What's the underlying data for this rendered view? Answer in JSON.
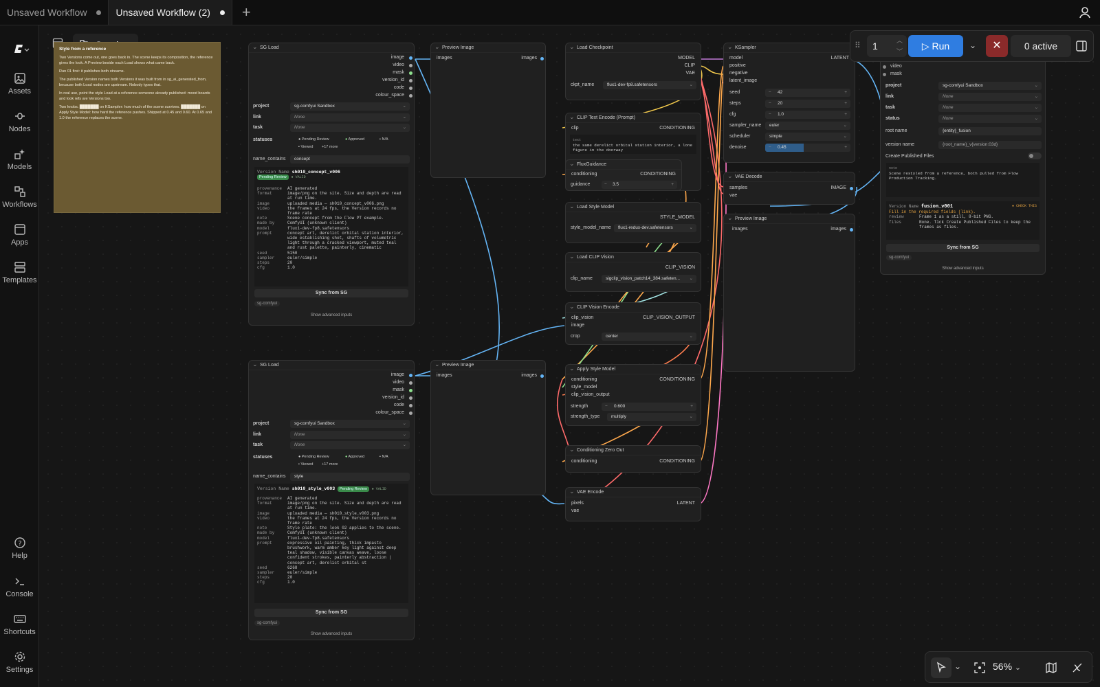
{
  "tabs": [
    {
      "label": "Unsaved Workflow",
      "active": false
    },
    {
      "label": "Unsaved Workflow (2)",
      "active": true
    }
  ],
  "sidebar": {
    "items": [
      {
        "label": "Assets",
        "icon": "image-icon"
      },
      {
        "label": "Nodes",
        "icon": "nodes-icon"
      },
      {
        "label": "Models",
        "icon": "models-icon"
      },
      {
        "label": "Workflows",
        "icon": "workflows-icon"
      },
      {
        "label": "Apps",
        "icon": "apps-icon"
      },
      {
        "label": "Templates",
        "icon": "templates-icon"
      }
    ],
    "bottom": [
      {
        "label": "Help"
      },
      {
        "label": "Console"
      },
      {
        "label": "Shortcuts"
      },
      {
        "label": "Settings"
      }
    ]
  },
  "graph_button": "Graph",
  "note": {
    "title": "Style from a reference",
    "paragraphs": [
      "Two Versions come out, one goes back in. The scene keeps its composition, the reference gives the look. A Preview beside each Load shows what came back.",
      "Run 01 first: it publishes both streams.",
      "The published Version names both Versions it was built from in sg_ai_generated_from, because both Load nodes are upstream. Nobody types that.",
      "In real use, point the style Load at a reference someone already published: mood boards and look refs are Versions too.",
      "Two knobs. ███████ on KSampler: how much of the scene survives. ███████ on Apply Style Model: how hard the reference pushes. Shipped at 0.45 and 0.60. At 0.65 and 1.0 the reference replaces the scene."
    ]
  },
  "sgload1": {
    "title": "SG Load",
    "outputs": [
      "image",
      "video",
      "mask",
      "version_id",
      "code",
      "colour_space"
    ],
    "project_label": "project",
    "project": "sg-comfyui Sandbox",
    "link_label": "link",
    "link": "None",
    "task_label": "task",
    "task": "None",
    "statuses_label": "statuses",
    "status1": "Pending Review",
    "status2": "Approved",
    "status3": "N/A",
    "status4": "Viewed",
    "more": "+17 more",
    "name_contains_label": "name_contains",
    "name_contains": "concept",
    "version_name_label": "Version Name",
    "version_name": "sh010_concept_v006",
    "badge": "Pending Review",
    "valid": "● VALID",
    "meta": [
      [
        "provenance",
        "AI generated"
      ],
      [
        "format",
        "image/png on the site. Size and depth are read at run time."
      ],
      [
        "image",
        "uploaded media — sh010_concept_v006.png"
      ],
      [
        "video",
        "the frames at 24 fps, the Version records no frame rate"
      ],
      [
        "note",
        "Scene concept from the Flow PT example."
      ],
      [
        "made by",
        "ComfyUI (unknown client)"
      ],
      [
        "model",
        "flux1-dev-fp8.safetensors"
      ],
      [
        "prompt",
        "concept art, derelict orbital station interior, wide establishing shot, shafts of volumetric light through a cracked viewport, muted teal and rust palette, painterly, cinematic"
      ],
      [
        "seed",
        "5150"
      ],
      [
        "sampler",
        "euler/simple"
      ],
      [
        "steps",
        "20"
      ],
      [
        "cfg",
        "1.0"
      ]
    ],
    "sync": "Sync from SG",
    "tag": "sg-comfyui",
    "advanced": "Show advanced inputs"
  },
  "sgload2": {
    "title": "SG Load",
    "outputs": [
      "image",
      "video",
      "mask",
      "version_id",
      "code",
      "colour_space"
    ],
    "project_label": "project",
    "project": "sg-comfyui Sandbox",
    "link_label": "link",
    "link": "None",
    "task_label": "task",
    "task": "None",
    "statuses_label": "statuses",
    "status1": "Pending Review",
    "status2": "Approved",
    "status3": "N/A",
    "status4": "Viewed",
    "more": "+17 more",
    "name_contains_label": "name_contains",
    "name_contains": "style",
    "version_name_label": "Version Name",
    "version_name": "sh010_style_v003",
    "badge": "Pending Review",
    "valid": "● VALID",
    "meta": [
      [
        "provenance",
        "AI generated"
      ],
      [
        "format",
        "image/png on the site. Size and depth are read at run time."
      ],
      [
        "image",
        "uploaded media — sh010_style_v003.png"
      ],
      [
        "video",
        "the frames at 24 fps, the Version records no frame rate"
      ],
      [
        "note",
        "Style plate: the look 02 applies to the scene."
      ],
      [
        "made by",
        "ComfyUI (unknown client)"
      ],
      [
        "model",
        "flux1-dev-fp8.safetensors"
      ],
      [
        "prompt",
        "expressive oil painting, thick impasto brushwork, warm amber key light against deep teal shadow, visible canvas weave, loose confident strokes, painterly abstraction | concept art, derelict orbital st"
      ],
      [
        "seed",
        "6268"
      ],
      [
        "sampler",
        "euler/simple"
      ],
      [
        "steps",
        "20"
      ],
      [
        "cfg",
        "1.0"
      ]
    ],
    "sync": "Sync from SG",
    "tag": "sg-comfyui",
    "advanced": "Show advanced inputs"
  },
  "preview1": {
    "title": "Preview Image",
    "in": "images",
    "out": "images"
  },
  "preview2": {
    "title": "Preview Image",
    "in": "images",
    "out": "images"
  },
  "preview3": {
    "title": "Preview Image",
    "in": "images",
    "out": "images"
  },
  "loadckpt": {
    "title": "Load Checkpoint",
    "outs": [
      "MODEL",
      "CLIP",
      "VAE"
    ],
    "field_label": "ckpt_name",
    "field": "flux1-dev-fp8.safetensors"
  },
  "cliptext": {
    "title": "CLIP Text Encode (Prompt)",
    "in": "clip",
    "out": "CONDITIONING",
    "text_label": "text",
    "text": "the same derelict orbital station interior, a lone figure in the doorway"
  },
  "fluxguid": {
    "title": "FluxGuidance",
    "in": "conditioning",
    "out": "CONDITIONING",
    "label": "guidance",
    "value": "3.5"
  },
  "loadstyle": {
    "title": "Load Style Model",
    "out": "STYLE_MODEL",
    "label": "style_model_name",
    "value": "flux1-redux-dev.safetensors"
  },
  "loadclipv": {
    "title": "Load CLIP Vision",
    "out": "CLIP_VISION",
    "label": "clip_name",
    "value": "sigclip_vision_patch14_384.safeten..."
  },
  "clipvenc": {
    "title": "CLIP Vision Encode",
    "ins": [
      "clip_vision",
      "image"
    ],
    "out": "CLIP_VISION_OUTPUT",
    "label": "crop",
    "value": "center"
  },
  "applystyle": {
    "title": "Apply Style Model",
    "ins": [
      "conditioning",
      "style_model",
      "clip_vision_output"
    ],
    "out": "CONDITIONING",
    "strength_label": "strength",
    "strength": "0.600",
    "type_label": "strength_type",
    "type": "multiply"
  },
  "condzero": {
    "title": "Conditioning Zero Out",
    "in": "conditioning",
    "out": "CONDITIONING"
  },
  "vaeenc": {
    "title": "VAE Encode",
    "ins": [
      "pixels",
      "vae"
    ],
    "out": "LATENT"
  },
  "ksampler": {
    "title": "KSampler",
    "ins": [
      "model",
      "positive",
      "negative",
      "latent_image"
    ],
    "out": "LATENT",
    "seed_label": "seed",
    "seed": "42",
    "steps_label": "steps",
    "steps": "20",
    "cfg_label": "cfg",
    "cfg": "1.0",
    "sampler_label": "sampler_name",
    "sampler": "euler",
    "scheduler_label": "scheduler",
    "scheduler": "simple",
    "denoise_label": "denoise",
    "denoise": "0.45",
    "denoise_fraction": 0.45
  },
  "vaedec": {
    "title": "VAE Decode",
    "ins": [
      "samples",
      "vae"
    ],
    "out": "IMAGE"
  },
  "publish": {
    "ins": [
      "video",
      "mask"
    ],
    "project_label": "project",
    "project": "sg-comfyui Sandbox",
    "link_label": "link",
    "link": "None",
    "task_label": "task",
    "task": "None",
    "status_label": "status",
    "status": "None",
    "root_label": "root name",
    "root": "{entity}_fusion",
    "vname_label": "version name",
    "vname": "{root_name}_v{version:03d}",
    "cpf_label": "Create Published Files",
    "note_label": "note",
    "note": "Scene restyled from a reference, both pulled from Flow Production Tracking.",
    "vn_label": "Version Name",
    "vn": "fusion_v001",
    "check": "● CHECK THIS",
    "fill": "Fill in the required fields (link).",
    "review_label": "review",
    "review": "Frame 1 as a still, 8-bit PNG.",
    "files_label": "files",
    "files": "None. Tick Create Published Files to keep the frames as files.",
    "sync": "Sync from SG",
    "tag": "sg-comfyui",
    "advanced": "Show advanced inputs"
  },
  "runbar": {
    "count": "1",
    "run": "Run",
    "active": "0 active"
  },
  "zoom": "56%",
  "colors": {
    "accent": "#2f7de1",
    "badge": "#3a8a4a",
    "note": "#6b5a32"
  }
}
